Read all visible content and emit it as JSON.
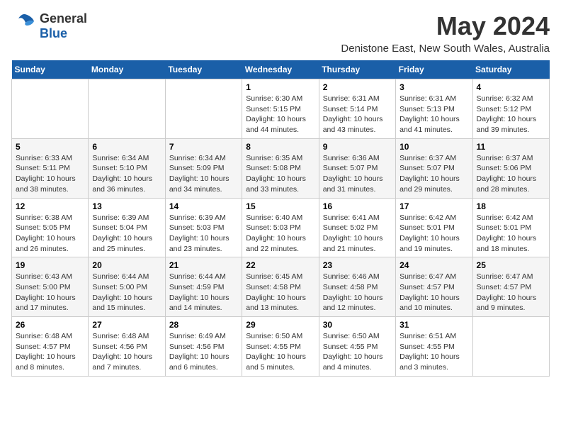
{
  "logo": {
    "text_general": "General",
    "text_blue": "Blue"
  },
  "title": "May 2024",
  "location": "Denistone East, New South Wales, Australia",
  "days_of_week": [
    "Sunday",
    "Monday",
    "Tuesday",
    "Wednesday",
    "Thursday",
    "Friday",
    "Saturday"
  ],
  "weeks": [
    [
      {
        "day": "",
        "info": ""
      },
      {
        "day": "",
        "info": ""
      },
      {
        "day": "",
        "info": ""
      },
      {
        "day": "1",
        "info": "Sunrise: 6:30 AM\nSunset: 5:15 PM\nDaylight: 10 hours\nand 44 minutes."
      },
      {
        "day": "2",
        "info": "Sunrise: 6:31 AM\nSunset: 5:14 PM\nDaylight: 10 hours\nand 43 minutes."
      },
      {
        "day": "3",
        "info": "Sunrise: 6:31 AM\nSunset: 5:13 PM\nDaylight: 10 hours\nand 41 minutes."
      },
      {
        "day": "4",
        "info": "Sunrise: 6:32 AM\nSunset: 5:12 PM\nDaylight: 10 hours\nand 39 minutes."
      }
    ],
    [
      {
        "day": "5",
        "info": "Sunrise: 6:33 AM\nSunset: 5:11 PM\nDaylight: 10 hours\nand 38 minutes."
      },
      {
        "day": "6",
        "info": "Sunrise: 6:34 AM\nSunset: 5:10 PM\nDaylight: 10 hours\nand 36 minutes."
      },
      {
        "day": "7",
        "info": "Sunrise: 6:34 AM\nSunset: 5:09 PM\nDaylight: 10 hours\nand 34 minutes."
      },
      {
        "day": "8",
        "info": "Sunrise: 6:35 AM\nSunset: 5:08 PM\nDaylight: 10 hours\nand 33 minutes."
      },
      {
        "day": "9",
        "info": "Sunrise: 6:36 AM\nSunset: 5:07 PM\nDaylight: 10 hours\nand 31 minutes."
      },
      {
        "day": "10",
        "info": "Sunrise: 6:37 AM\nSunset: 5:07 PM\nDaylight: 10 hours\nand 29 minutes."
      },
      {
        "day": "11",
        "info": "Sunrise: 6:37 AM\nSunset: 5:06 PM\nDaylight: 10 hours\nand 28 minutes."
      }
    ],
    [
      {
        "day": "12",
        "info": "Sunrise: 6:38 AM\nSunset: 5:05 PM\nDaylight: 10 hours\nand 26 minutes."
      },
      {
        "day": "13",
        "info": "Sunrise: 6:39 AM\nSunset: 5:04 PM\nDaylight: 10 hours\nand 25 minutes."
      },
      {
        "day": "14",
        "info": "Sunrise: 6:39 AM\nSunset: 5:03 PM\nDaylight: 10 hours\nand 23 minutes."
      },
      {
        "day": "15",
        "info": "Sunrise: 6:40 AM\nSunset: 5:03 PM\nDaylight: 10 hours\nand 22 minutes."
      },
      {
        "day": "16",
        "info": "Sunrise: 6:41 AM\nSunset: 5:02 PM\nDaylight: 10 hours\nand 21 minutes."
      },
      {
        "day": "17",
        "info": "Sunrise: 6:42 AM\nSunset: 5:01 PM\nDaylight: 10 hours\nand 19 minutes."
      },
      {
        "day": "18",
        "info": "Sunrise: 6:42 AM\nSunset: 5:01 PM\nDaylight: 10 hours\nand 18 minutes."
      }
    ],
    [
      {
        "day": "19",
        "info": "Sunrise: 6:43 AM\nSunset: 5:00 PM\nDaylight: 10 hours\nand 17 minutes."
      },
      {
        "day": "20",
        "info": "Sunrise: 6:44 AM\nSunset: 5:00 PM\nDaylight: 10 hours\nand 15 minutes."
      },
      {
        "day": "21",
        "info": "Sunrise: 6:44 AM\nSunset: 4:59 PM\nDaylight: 10 hours\nand 14 minutes."
      },
      {
        "day": "22",
        "info": "Sunrise: 6:45 AM\nSunset: 4:58 PM\nDaylight: 10 hours\nand 13 minutes."
      },
      {
        "day": "23",
        "info": "Sunrise: 6:46 AM\nSunset: 4:58 PM\nDaylight: 10 hours\nand 12 minutes."
      },
      {
        "day": "24",
        "info": "Sunrise: 6:47 AM\nSunset: 4:57 PM\nDaylight: 10 hours\nand 10 minutes."
      },
      {
        "day": "25",
        "info": "Sunrise: 6:47 AM\nSunset: 4:57 PM\nDaylight: 10 hours\nand 9 minutes."
      }
    ],
    [
      {
        "day": "26",
        "info": "Sunrise: 6:48 AM\nSunset: 4:57 PM\nDaylight: 10 hours\nand 8 minutes."
      },
      {
        "day": "27",
        "info": "Sunrise: 6:48 AM\nSunset: 4:56 PM\nDaylight: 10 hours\nand 7 minutes."
      },
      {
        "day": "28",
        "info": "Sunrise: 6:49 AM\nSunset: 4:56 PM\nDaylight: 10 hours\nand 6 minutes."
      },
      {
        "day": "29",
        "info": "Sunrise: 6:50 AM\nSunset: 4:55 PM\nDaylight: 10 hours\nand 5 minutes."
      },
      {
        "day": "30",
        "info": "Sunrise: 6:50 AM\nSunset: 4:55 PM\nDaylight: 10 hours\nand 4 minutes."
      },
      {
        "day": "31",
        "info": "Sunrise: 6:51 AM\nSunset: 4:55 PM\nDaylight: 10 hours\nand 3 minutes."
      },
      {
        "day": "",
        "info": ""
      }
    ]
  ]
}
